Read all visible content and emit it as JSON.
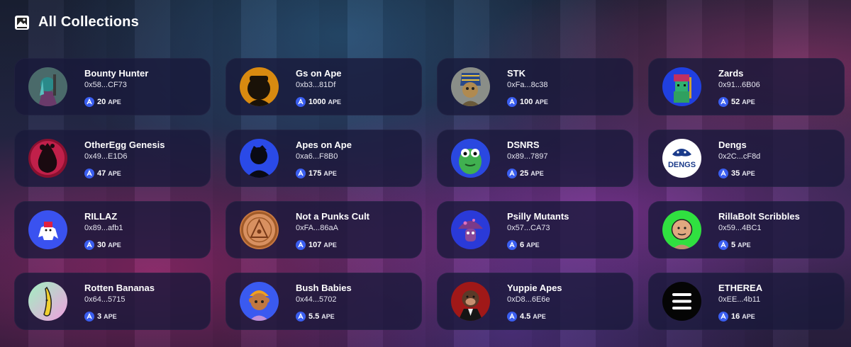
{
  "header": {
    "title": "All Collections",
    "icon": "image-gallery-icon"
  },
  "currency_icon": "ape-coin-icon",
  "collections": [
    {
      "name": "Bounty Hunter",
      "address": "0x58...CF73",
      "price": "20",
      "unit": "APE"
    },
    {
      "name": "Gs on Ape",
      "address": "0xb3...81Df",
      "price": "1000",
      "unit": "APE"
    },
    {
      "name": "STK",
      "address": "0xFa...8c38",
      "price": "100",
      "unit": "APE"
    },
    {
      "name": "Zards",
      "address": "0x91...6B06",
      "price": "52",
      "unit": "APE"
    },
    {
      "name": "OtherEgg Genesis",
      "address": "0x49...E1D6",
      "price": "47",
      "unit": "APE"
    },
    {
      "name": "Apes on Ape",
      "address": "0xa6...F8B0",
      "price": "175",
      "unit": "APE"
    },
    {
      "name": "DSNRS",
      "address": "0x89...7897",
      "price": "25",
      "unit": "APE"
    },
    {
      "name": "Dengs",
      "address": "0x2C...cF8d",
      "price": "35",
      "unit": "APE",
      "avatar_text": "DENGS"
    },
    {
      "name": "RILLAZ",
      "address": "0x89...afb1",
      "price": "30",
      "unit": "APE"
    },
    {
      "name": "Not a Punks Cult",
      "address": "0xFA...86aA",
      "price": "107",
      "unit": "APE"
    },
    {
      "name": "Psilly Mutants",
      "address": "0x57...CA73",
      "price": "6",
      "unit": "APE"
    },
    {
      "name": "RillaBolt Scribbles",
      "address": "0x59...4BC1",
      "price": "5",
      "unit": "APE"
    },
    {
      "name": "Rotten Bananas",
      "address": "0x64...5715",
      "price": "3",
      "unit": "APE"
    },
    {
      "name": "Bush Babies",
      "address": "0x44...5702",
      "price": "5.5",
      "unit": "APE"
    },
    {
      "name": "Yuppie Apes",
      "address": "0xD8...6E6e",
      "price": "4.5",
      "unit": "APE"
    },
    {
      "name": "ETHEREA",
      "address": "0xEE...4b11",
      "price": "16",
      "unit": "APE"
    }
  ]
}
